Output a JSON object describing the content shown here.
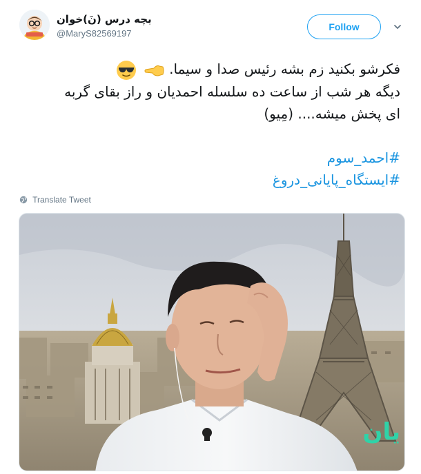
{
  "user": {
    "display_name": "بچه درس (نَ)خوان",
    "handle": "@MaryS82569197"
  },
  "follow_button": {
    "label": "Follow"
  },
  "tweet": {
    "line1": "فکرشو بکنید زم بشه رئیس صدا و سیما.",
    "line2": "دیگه هر شب از ساعت ده سلسله احمدیان و راز بقای گربه",
    "line3": "ای پخش میشه....  (مِیو)",
    "hashtags": [
      "#احمد_سوم",
      "#ایستگاه_پایانی_دروغ"
    ]
  },
  "translate": {
    "label": "Translate Tweet"
  },
  "media": {
    "watermark": "یان"
  },
  "colors": {
    "accent": "#1da1f2",
    "link": "#1b95e0",
    "secondary_text": "#657786"
  },
  "icons": {
    "avatar": "cartoon-avatar-icon",
    "chevron": "chevron-down-icon",
    "globe": "globe-icon",
    "emoji1": "sunglasses-emoji-icon",
    "emoji2": "pointing-hand-emoji-icon"
  }
}
